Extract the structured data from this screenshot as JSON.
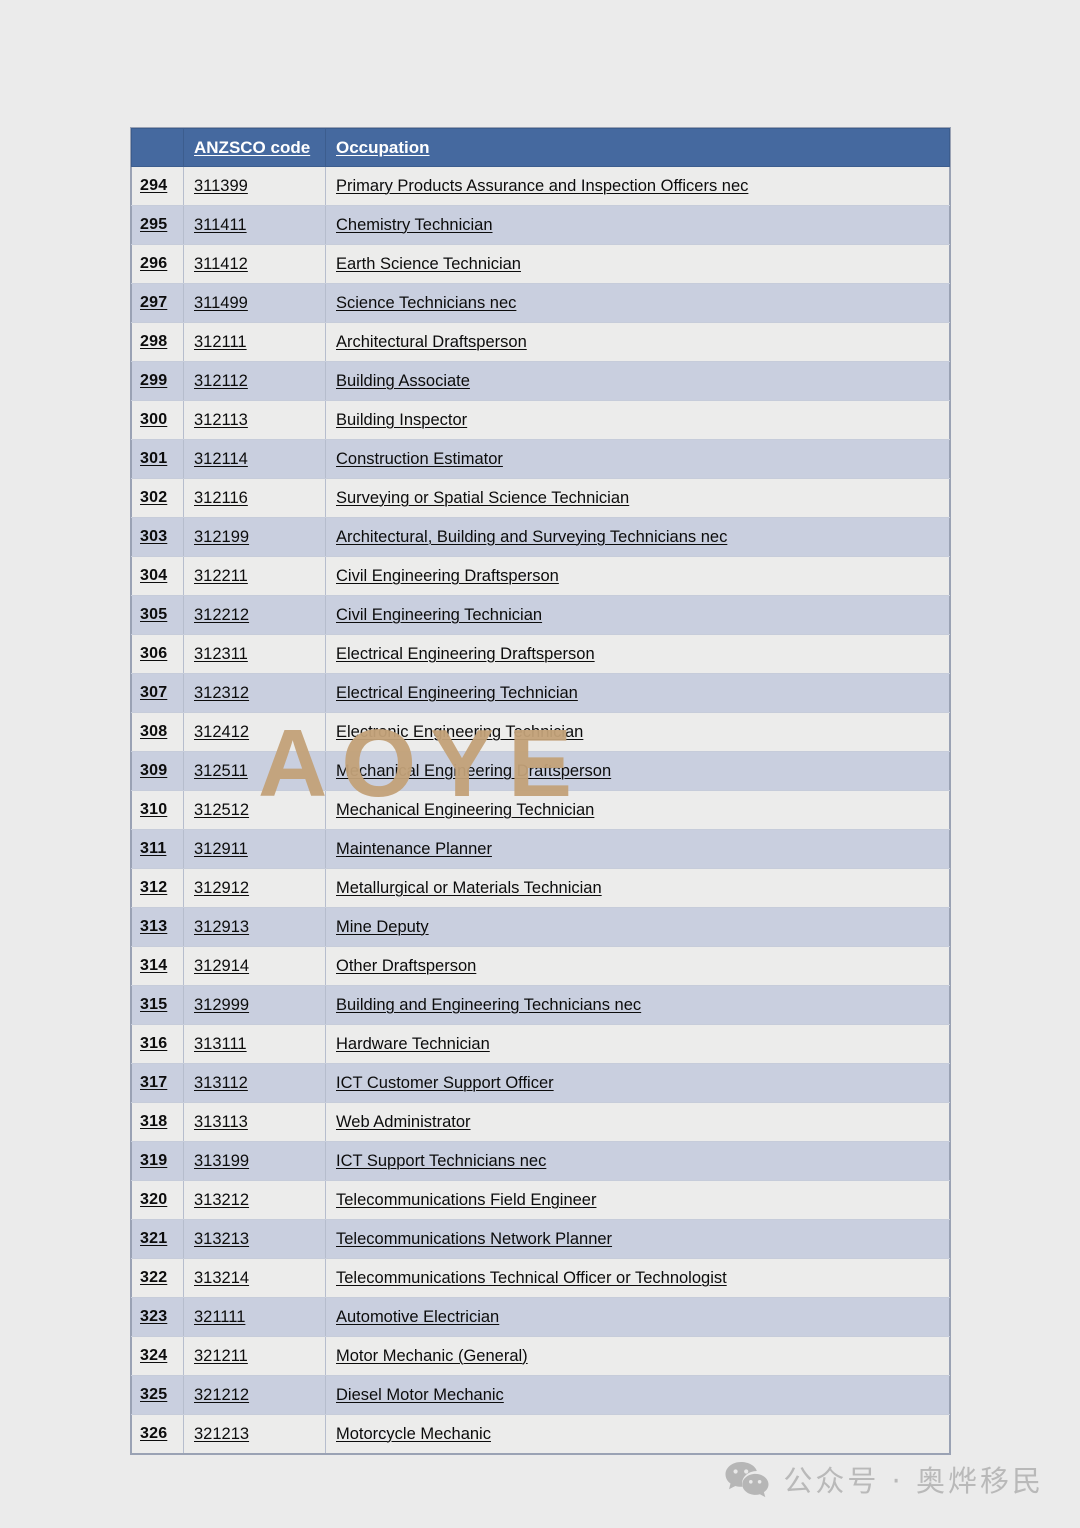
{
  "table": {
    "columns": [
      "",
      "ANZSCO code",
      "Occupation"
    ],
    "rows": [
      {
        "index": "294",
        "code": "311399",
        "occupation": "Primary Products Assurance and Inspection Officers nec"
      },
      {
        "index": "295",
        "code": "311411",
        "occupation": "Chemistry Technician"
      },
      {
        "index": "296",
        "code": "311412",
        "occupation": "Earth Science Technician"
      },
      {
        "index": "297",
        "code": "311499",
        "occupation": "Science Technicians nec"
      },
      {
        "index": "298",
        "code": "312111",
        "occupation": "Architectural Draftsperson"
      },
      {
        "index": "299",
        "code": "312112",
        "occupation": "Building Associate"
      },
      {
        "index": "300",
        "code": "312113",
        "occupation": "Building Inspector"
      },
      {
        "index": "301",
        "code": "312114",
        "occupation": "Construction Estimator"
      },
      {
        "index": "302",
        "code": "312116",
        "occupation": "Surveying or Spatial Science Technician"
      },
      {
        "index": "303",
        "code": "312199",
        "occupation": "Architectural, Building and Surveying Technicians nec"
      },
      {
        "index": "304",
        "code": "312211",
        "occupation": "Civil Engineering Draftsperson"
      },
      {
        "index": "305",
        "code": "312212",
        "occupation": "Civil Engineering Technician"
      },
      {
        "index": "306",
        "code": "312311",
        "occupation": "Electrical Engineering Draftsperson"
      },
      {
        "index": "307",
        "code": "312312",
        "occupation": "Electrical Engineering Technician"
      },
      {
        "index": "308",
        "code": "312412",
        "occupation": "Electronic Engineering Technician"
      },
      {
        "index": "309",
        "code": "312511",
        "occupation": "Mechanical Engineering Draftsperson"
      },
      {
        "index": "310",
        "code": "312512",
        "occupation": "Mechanical Engineering Technician"
      },
      {
        "index": "311",
        "code": "312911",
        "occupation": "Maintenance Planner"
      },
      {
        "index": "312",
        "code": "312912",
        "occupation": "Metallurgical or Materials Technician"
      },
      {
        "index": "313",
        "code": "312913",
        "occupation": "Mine Deputy"
      },
      {
        "index": "314",
        "code": "312914",
        "occupation": "Other Draftsperson"
      },
      {
        "index": "315",
        "code": "312999",
        "occupation": "Building and Engineering Technicians nec"
      },
      {
        "index": "316",
        "code": "313111",
        "occupation": "Hardware Technician"
      },
      {
        "index": "317",
        "code": "313112",
        "occupation": "ICT Customer Support Officer"
      },
      {
        "index": "318",
        "code": "313113",
        "occupation": "Web Administrator"
      },
      {
        "index": "319",
        "code": "313199",
        "occupation": "ICT Support Technicians nec"
      },
      {
        "index": "320",
        "code": "313212",
        "occupation": "Telecommunications Field Engineer"
      },
      {
        "index": "321",
        "code": "313213",
        "occupation": "Telecommunications Network Planner"
      },
      {
        "index": "322",
        "code": "313214",
        "occupation": "Telecommunications Technical Officer or Technologist"
      },
      {
        "index": "323",
        "code": "321111",
        "occupation": "Automotive Electrician"
      },
      {
        "index": "324",
        "code": "321211",
        "occupation": "Motor Mechanic (General)"
      },
      {
        "index": "325",
        "code": "321212",
        "occupation": "Diesel Motor Mechanic"
      },
      {
        "index": "326",
        "code": "321213",
        "occupation": "Motorcycle Mechanic"
      }
    ]
  },
  "watermark": {
    "text": "AOYE",
    "color": "#c3a279"
  },
  "footer": {
    "icon": "wechat-icon",
    "text": "公众号 · 奥烨移民",
    "color": "#b9b9b9"
  },
  "colors": {
    "header_bg": "#45699f",
    "row_odd_bg": "#ececeb",
    "row_even_bg": "#c9cfdf",
    "page_bg": "#ebebeb",
    "border": "#9aa2b4"
  }
}
